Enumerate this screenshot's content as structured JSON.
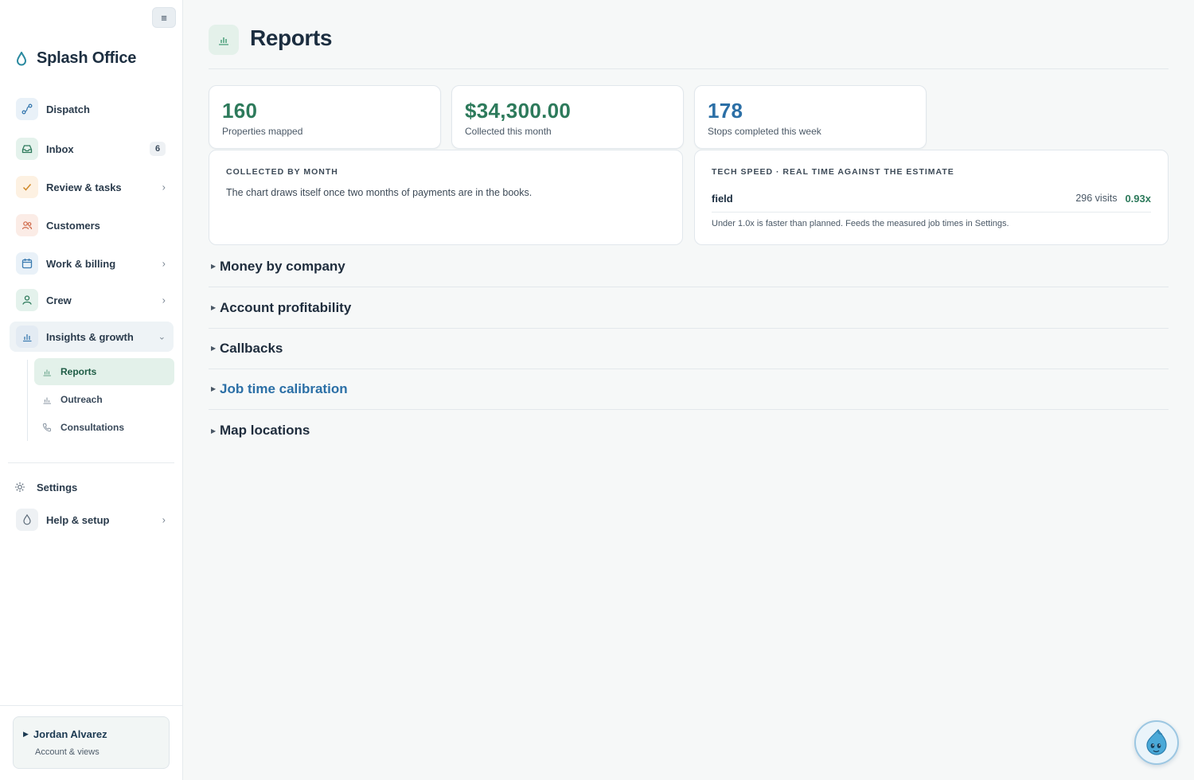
{
  "brand": {
    "name": "Splash Office"
  },
  "sidebar": {
    "toggle_glyph": "≡",
    "items": [
      {
        "id": "dispatch",
        "label": "Dispatch",
        "icon": "route-icon"
      },
      {
        "id": "inbox",
        "label": "Inbox",
        "icon": "inbox-icon",
        "badge": "6"
      },
      {
        "id": "review",
        "label": "Review & tasks",
        "icon": "check-icon",
        "chevron": "›"
      },
      {
        "id": "customers",
        "label": "Customers",
        "icon": "users-icon"
      },
      {
        "id": "work",
        "label": "Work & billing",
        "icon": "calendar-icon",
        "chevron": "›"
      },
      {
        "id": "crew",
        "label": "Crew",
        "icon": "person-icon",
        "chevron": "›"
      },
      {
        "id": "insights",
        "label": "Insights & growth",
        "icon": "bar-chart-icon",
        "chevron": "⌄"
      }
    ],
    "sub_items": [
      {
        "id": "reports",
        "label": "Reports",
        "icon": "bar-chart-icon"
      },
      {
        "id": "outreach",
        "label": "Outreach",
        "icon": "bar-chart-icon"
      },
      {
        "id": "consultations",
        "label": "Consultations",
        "icon": "phone-icon"
      }
    ],
    "settings": {
      "label": "Settings",
      "icon": "gear-icon"
    },
    "help": {
      "label": "Help & setup",
      "icon": "drop-icon",
      "chevron": "›"
    },
    "user": {
      "name": "Jordan Alvarez",
      "subtitle": "Account & views",
      "toggle": "▶"
    }
  },
  "page": {
    "title": "Reports",
    "icon": "bar-chart-icon"
  },
  "stats": [
    {
      "value": "160",
      "caption": "Properties mapped",
      "color": "#2d7a5b"
    },
    {
      "value": "$34,300.00",
      "caption": "Collected this month",
      "color": "#2d7a5b"
    },
    {
      "value": "178",
      "caption": "Stops completed this week",
      "color": "#2b6fa6"
    }
  ],
  "collected_panel": {
    "title": "COLLECTED BY MONTH",
    "body": "The chart draws itself once two months of payments are in the books."
  },
  "speed_panel": {
    "title": "TECH SPEED · REAL TIME AGAINST THE ESTIMATE",
    "tech": "field",
    "visits": "296 visits",
    "ratio": "0.93x",
    "note": "Under 1.0x is faster than planned. Feeds the measured job times in Settings."
  },
  "sections": [
    {
      "title": "Money by company",
      "highlight": false
    },
    {
      "title": "Account profitability",
      "highlight": false
    },
    {
      "title": "Callbacks",
      "highlight": false
    },
    {
      "title": "Job time calibration",
      "highlight": true
    },
    {
      "title": "Map locations",
      "highlight": false
    }
  ],
  "section_toggle_glyph": "▶",
  "colors": {
    "accent_green": "#2d7a5b",
    "accent_blue": "#2b6fa6",
    "active_sub_bg": "#e3f1ea"
  }
}
